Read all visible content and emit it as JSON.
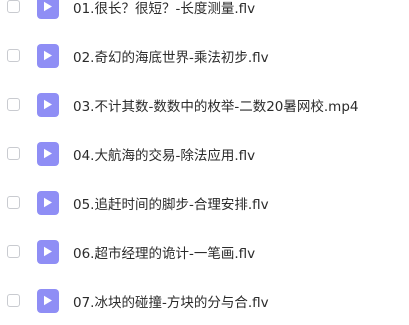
{
  "files": [
    {
      "name": "01.很长？很短？-长度测量.flv",
      "icon": "video-file-icon"
    },
    {
      "name": "02.奇幻的海底世界-乘法初步.flv",
      "icon": "video-file-icon"
    },
    {
      "name": "03.不计其数-数数中的枚举-二数20暑网校.mp4",
      "icon": "video-file-icon"
    },
    {
      "name": "04.大航海的交易-除法应用.flv",
      "icon": "video-file-icon"
    },
    {
      "name": "05.追赶时间的脚步-合理安排.flv",
      "icon": "video-file-icon"
    },
    {
      "name": "06.超市经理的诡计-一笔画.flv",
      "icon": "video-file-icon"
    },
    {
      "name": "07.冰块的碰撞-方块的分与合.flv",
      "icon": "video-file-icon"
    }
  ],
  "colors": {
    "icon_background": "#8f8ef5",
    "checkbox_border": "#c9cbd0",
    "text": "#2b2b2b"
  }
}
